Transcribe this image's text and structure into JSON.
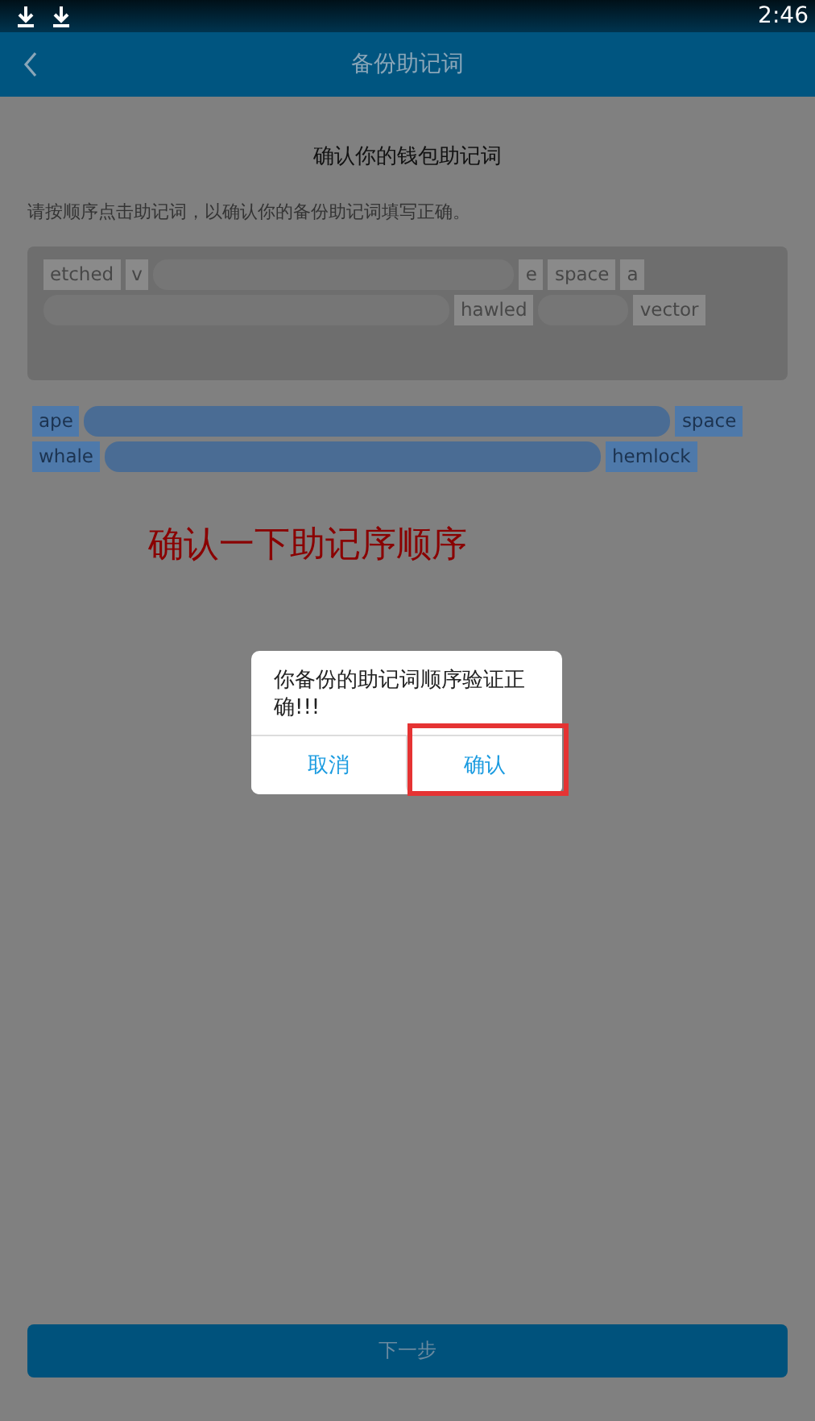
{
  "status_bar": {
    "time": "2:46",
    "icons": [
      {
        "kind": "download"
      },
      {
        "kind": "download"
      }
    ]
  },
  "header": {
    "title": "备份助记词"
  },
  "heading": "确认你的钱包助记词",
  "instruction": "请按顺序点击助记词，以确认你的备份助记词填写正确。",
  "word_pool": [
    {
      "kind": "word",
      "text": "etched"
    },
    {
      "kind": "word",
      "text": "v"
    },
    {
      "kind": "blur"
    },
    {
      "kind": "word",
      "text": "e"
    },
    {
      "kind": "word",
      "text": "space"
    },
    {
      "kind": "word",
      "text": "a"
    },
    {
      "kind": "blur"
    },
    {
      "kind": "word",
      "text": "hawled"
    },
    {
      "kind": "blur"
    },
    {
      "kind": "word",
      "text": "vector"
    }
  ],
  "selected_words": [
    {
      "kind": "word",
      "text": "ape"
    },
    {
      "kind": "blur"
    },
    {
      "kind": "word",
      "text": "space"
    },
    {
      "kind": "word",
      "text": "whale"
    },
    {
      "kind": "blur"
    },
    {
      "kind": "word",
      "text": "hemlock"
    }
  ],
  "annotation": "确认一下助记序顺序",
  "dialog": {
    "message": "你备份的助记词顺序验证正确!!!",
    "buttons": [
      {
        "label": "取消",
        "highlighted": false
      },
      {
        "label": "确认",
        "highlighted": true
      }
    ]
  },
  "next_button": "下一步"
}
